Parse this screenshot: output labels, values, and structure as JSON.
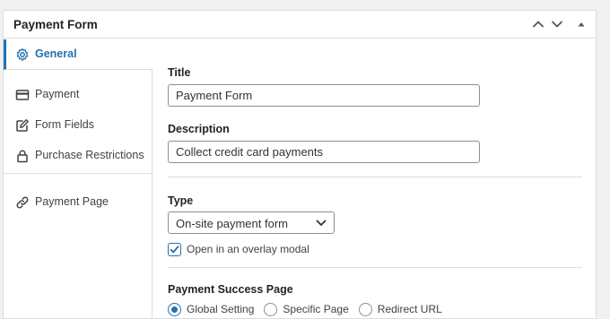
{
  "panel": {
    "title": "Payment Form"
  },
  "header_controls": [
    "move-up-icon",
    "move-down-icon",
    "toggle-panel-icon"
  ],
  "sidebar": {
    "tabs": [
      {
        "label": "General",
        "icon": "gear-icon",
        "active": true
      },
      {
        "label": "Payment",
        "icon": "credit-card-icon",
        "active": false
      },
      {
        "label": "Form Fields",
        "icon": "edit-icon",
        "active": false
      },
      {
        "label": "Purchase Restrictions",
        "icon": "lock-icon",
        "active": false
      },
      {
        "label": "Payment Page",
        "icon": "link-icon",
        "active": false
      }
    ]
  },
  "general": {
    "title_label": "Title",
    "title_value": "Payment Form",
    "description_label": "Description",
    "description_value": "Collect credit card payments",
    "type_label": "Type",
    "type_value": "On-site payment form",
    "overlay_label": "Open in an overlay modal",
    "overlay_checked": true,
    "success_label": "Payment Success Page",
    "success_options": [
      {
        "label": "Global Setting",
        "checked": true
      },
      {
        "label": "Specific Page",
        "checked": false
      },
      {
        "label": "Redirect URL",
        "checked": false
      }
    ]
  },
  "colors": {
    "accent": "#2271b1",
    "border": "#dcdcde",
    "text": "#1d2327"
  }
}
